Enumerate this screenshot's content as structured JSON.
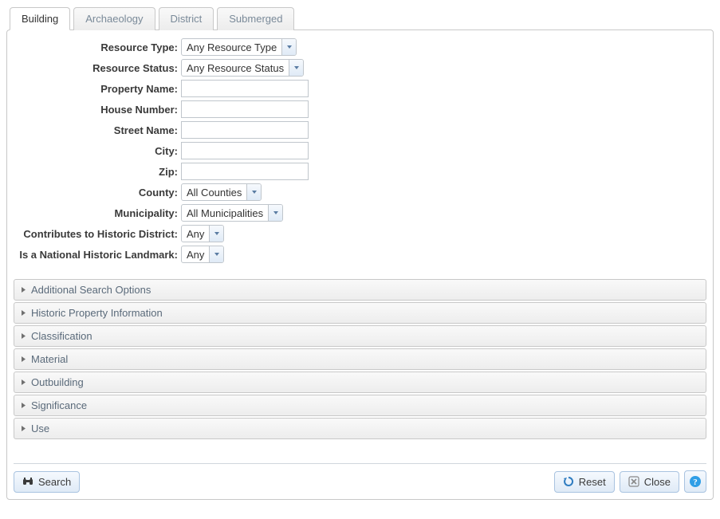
{
  "tabs": [
    {
      "label": "Building",
      "active": true
    },
    {
      "label": "Archaeology",
      "active": false
    },
    {
      "label": "District",
      "active": false
    },
    {
      "label": "Submerged",
      "active": false
    }
  ],
  "form": {
    "resource_type": {
      "label": "Resource Type:",
      "value": "Any Resource Type"
    },
    "resource_status": {
      "label": "Resource Status:",
      "value": "Any Resource Status"
    },
    "property_name": {
      "label": "Property Name:",
      "value": ""
    },
    "house_number": {
      "label": "House Number:",
      "value": ""
    },
    "street_name": {
      "label": "Street Name:",
      "value": ""
    },
    "city": {
      "label": "City:",
      "value": ""
    },
    "zip": {
      "label": "Zip:",
      "value": ""
    },
    "county": {
      "label": "County:",
      "value": "All Counties"
    },
    "municipality": {
      "label": "Municipality:",
      "value": "All Municipalities"
    },
    "contributes": {
      "label": "Contributes to Historic District:",
      "value": "Any"
    },
    "landmark": {
      "label": "Is a National Historic Landmark:",
      "value": "Any"
    }
  },
  "accordions": [
    "Additional Search Options",
    "Historic Property Information",
    "Classification",
    "Material",
    "Outbuilding",
    "Significance",
    "Use"
  ],
  "buttons": {
    "search": "Search",
    "reset": "Reset",
    "close": "Close"
  }
}
